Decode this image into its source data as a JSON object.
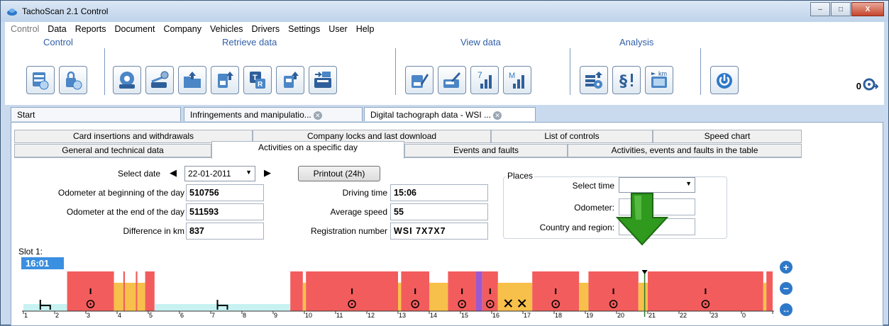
{
  "window": {
    "title": "TachoScan 2.1 Control",
    "buttons": {
      "minimize": "–",
      "maximize": "□",
      "close": "X"
    }
  },
  "menu": [
    {
      "label": "Control",
      "disabled": true
    },
    {
      "label": "Data"
    },
    {
      "label": "Reports"
    },
    {
      "label": "Document"
    },
    {
      "label": "Company"
    },
    {
      "label": "Vehicles"
    },
    {
      "label": "Drivers"
    },
    {
      "label": "Settings"
    },
    {
      "label": "User"
    },
    {
      "label": "Help"
    }
  ],
  "toolbar": {
    "groups": {
      "control": "Control",
      "retrieve": "Retrieve data",
      "view": "View data",
      "analysis": "Analysis"
    },
    "buttons": [
      {
        "name": "control-card-icon"
      },
      {
        "name": "control-lock-icon"
      },
      {
        "name": "download-card-icon"
      },
      {
        "name": "scanner-settings-icon"
      },
      {
        "name": "open-folder-icon"
      },
      {
        "name": "upload-card-icon"
      },
      {
        "name": "tacho-t-icon"
      },
      {
        "name": "vehicle-unit-upload-icon"
      },
      {
        "name": "card-reader-icon"
      },
      {
        "name": "view-card-icon"
      },
      {
        "name": "view-disc-icon"
      },
      {
        "name": "weekly-chart-icon"
      },
      {
        "name": "monthly-chart-icon"
      },
      {
        "name": "analysis-disc-icon"
      },
      {
        "name": "regulations-icon"
      },
      {
        "name": "km-book-icon"
      },
      {
        "name": "power-icon"
      }
    ],
    "weekly_digit": "7",
    "monthly_letter": "M",
    "km_text": "km",
    "t_letter": "T",
    "r_letter": "R",
    "right_count": "0"
  },
  "doc_tabs": [
    {
      "label": "Start"
    },
    {
      "label": "Infringements and manipulatio..."
    },
    {
      "label": "Digital tachograph data - WSI ..."
    }
  ],
  "panel_tabs": {
    "row1": [
      "Card insertions and withdrawals",
      "Company locks and last download",
      "List of controls",
      "Speed chart"
    ],
    "row2": [
      "General and technical data",
      "Activities on a specific day",
      "Events and faults",
      "Activities, events and faults in the table"
    ]
  },
  "form": {
    "select_date_label": "Select date",
    "date_value": "22-01-2011",
    "printout_label": "Printout (24h)",
    "odometer_begin_label": "Odometer at beginning of the day",
    "odometer_begin_value": "510756",
    "odometer_end_label": "Odometer at the end of the day",
    "odometer_end_value": "511593",
    "difference_label": "Difference in km",
    "difference_value": "837",
    "driving_time_label": "Driving time",
    "driving_time_value": "15:06",
    "average_speed_label": "Average speed",
    "average_speed_value": "55",
    "registration_label": "Registration number",
    "registration_value": "WSI 7X7X7"
  },
  "places": {
    "legend": "Places",
    "select_time_label": "Select time",
    "odometer_label": "Odometer:",
    "country_label": "Country and region:"
  },
  "slot": {
    "label": "Slot 1:",
    "time": "16:01"
  },
  "timeline": {
    "hour_labels": [
      "1",
      "2",
      "3",
      "4",
      "5",
      "6",
      "7",
      "8",
      "9",
      "10",
      "11",
      "12",
      "13",
      "14",
      "15",
      "16",
      "17",
      "18",
      "19",
      "20",
      "21",
      "22",
      "23",
      "0",
      "1"
    ],
    "colors": {
      "rest": "#c8f2f2",
      "driving": "#f25c5c",
      "work": "#f7c04a",
      "availability": "#9b59d0"
    },
    "segments": [
      {
        "start": 0.0,
        "end": 1.4,
        "activity": "rest"
      },
      {
        "start": 1.4,
        "end": 2.9,
        "activity": "driving"
      },
      {
        "start": 2.9,
        "end": 3.2,
        "activity": "work"
      },
      {
        "start": 3.2,
        "end": 3.25,
        "activity": "driving"
      },
      {
        "start": 3.25,
        "end": 3.6,
        "activity": "work"
      },
      {
        "start": 3.6,
        "end": 3.65,
        "activity": "driving"
      },
      {
        "start": 3.65,
        "end": 3.9,
        "activity": "work"
      },
      {
        "start": 3.9,
        "end": 4.2,
        "activity": "driving"
      },
      {
        "start": 4.2,
        "end": 8.55,
        "activity": "rest"
      },
      {
        "start": 8.55,
        "end": 8.95,
        "activity": "driving"
      },
      {
        "start": 8.95,
        "end": 9.05,
        "activity": "work"
      },
      {
        "start": 9.05,
        "end": 12.0,
        "activity": "driving"
      },
      {
        "start": 12.0,
        "end": 12.1,
        "activity": "work"
      },
      {
        "start": 12.1,
        "end": 13.0,
        "activity": "driving"
      },
      {
        "start": 13.0,
        "end": 13.6,
        "activity": "work"
      },
      {
        "start": 13.6,
        "end": 14.5,
        "activity": "driving"
      },
      {
        "start": 14.5,
        "end": 14.7,
        "activity": "availability"
      },
      {
        "start": 14.7,
        "end": 15.2,
        "activity": "driving"
      },
      {
        "start": 15.2,
        "end": 16.3,
        "activity": "work"
      },
      {
        "start": 16.3,
        "end": 17.8,
        "activity": "driving"
      },
      {
        "start": 17.8,
        "end": 18.1,
        "activity": "work"
      },
      {
        "start": 18.1,
        "end": 19.7,
        "activity": "driving"
      },
      {
        "start": 19.7,
        "end": 20.0,
        "activity": "work"
      },
      {
        "start": 20.0,
        "end": 23.7,
        "activity": "driving"
      },
      {
        "start": 23.7,
        "end": 23.8,
        "activity": "work"
      },
      {
        "start": 23.8,
        "end": 24.0,
        "activity": "driving"
      }
    ],
    "marker_time": 19.9
  },
  "side_buttons": {
    "zoom_in": "+",
    "zoom_out": "−",
    "fit": "↔"
  }
}
